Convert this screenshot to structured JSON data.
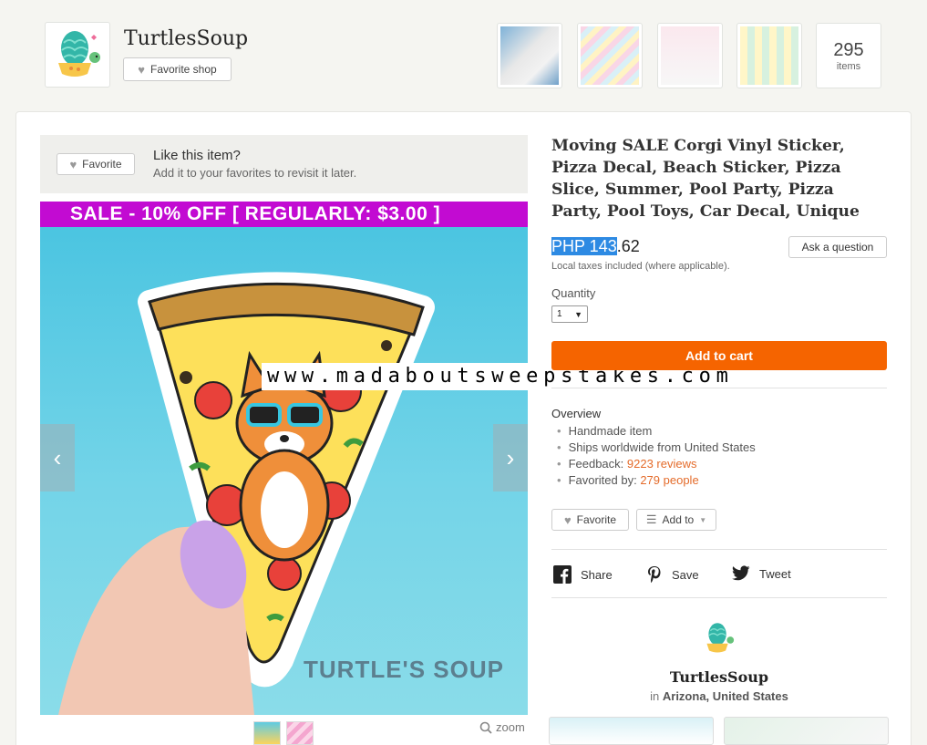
{
  "shop": {
    "name": "TurtlesSoup",
    "favorite_shop_label": "Favorite shop",
    "items_count": "295",
    "items_label": "items"
  },
  "favorite_panel": {
    "button_label": "Favorite",
    "title": "Like this item?",
    "subtitle": "Add it to your favorites to revisit it later."
  },
  "listing_image": {
    "sale_banner": "SALE - 10% OFF [ REGULARLY: $3.00 ]",
    "brand_text": "TURTLE'S SOUP",
    "watermark": "www.madaboutsweepstakes.com",
    "prev_arrow": "‹",
    "next_arrow": "›",
    "zoom_label": "zoom"
  },
  "listing": {
    "title": "Moving SALE Corgi Vinyl Sticker, Pizza Decal, Beach Sticker, Pizza Slice, Summer, Pool Party, Pizza Party, Pool Toys, Car Decal, Unique",
    "price_highlight": "PHP 143",
    "price_rest": ".62",
    "tax_note": "Local taxes included (where applicable).",
    "ask_label": "Ask a question",
    "quantity_label": "Quantity",
    "quantity_value": "1",
    "add_to_cart": "Add to cart"
  },
  "overview": {
    "heading": "Overview",
    "item1": "Handmade item",
    "item2": "Ships worldwide from United States",
    "feedback_label": "Feedback: ",
    "feedback_link": "9223 reviews",
    "favorited_label": "Favorited by: ",
    "favorited_link": "279 people"
  },
  "actions": {
    "favorite_label": "Favorite",
    "add_to_label": "Add to"
  },
  "social": {
    "share": "Share",
    "save": "Save",
    "tweet": "Tweet"
  },
  "seller": {
    "name": "TurtlesSoup",
    "location_prefix": "in ",
    "location": "Arizona, United States"
  },
  "colors": {
    "cart": "#f56400",
    "sale_banner": "#c20bd2",
    "link": "#e46b2a",
    "highlight": "#2d8ae3"
  }
}
